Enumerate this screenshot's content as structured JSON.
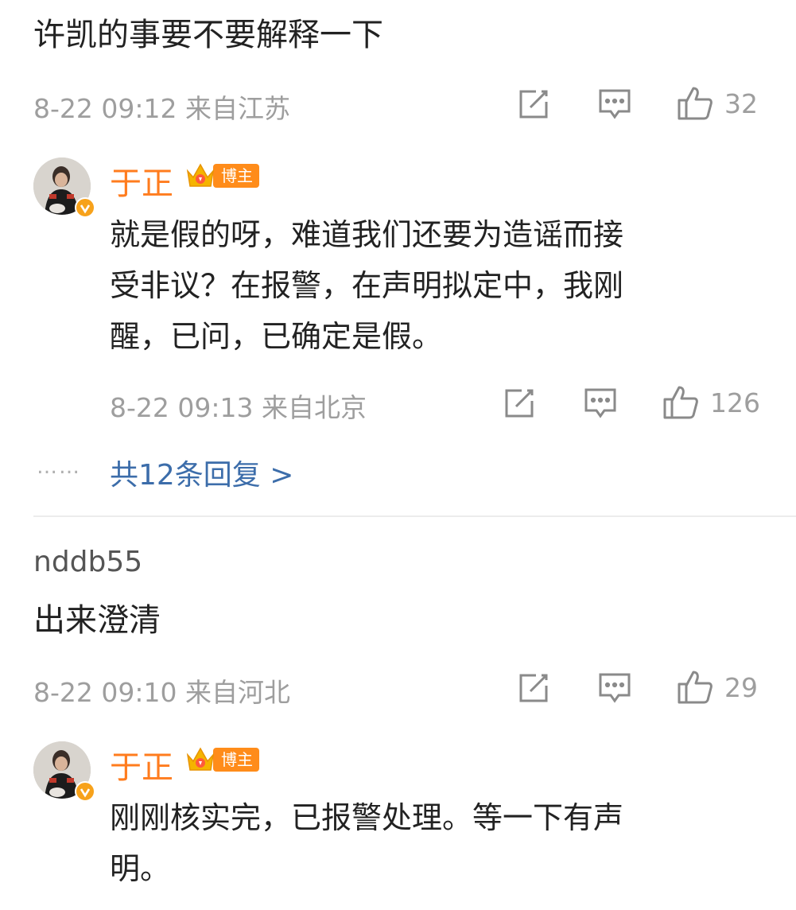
{
  "comments": [
    {
      "text": "许凯的事要不要解释一下",
      "time": "8-22 09:12",
      "location": "来自江苏",
      "likes": "32",
      "reply": {
        "username": "于正",
        "badge": "博主",
        "text_lines": [
          "就是假的呀，难道我们还要为造谣而接",
          "受非议？在报警，在声明拟定中，我刚",
          "醒，已问，已确定是假。"
        ],
        "time": "8-22 09:13",
        "location": "来自北京",
        "likes": "126"
      },
      "more_replies": "共12条回复 >",
      "ellipsis": "……"
    },
    {
      "username": "nddb55",
      "text": "出来澄清",
      "time": "8-22 09:10",
      "location": "来自河北",
      "likes": "29",
      "reply": {
        "username": "于正",
        "badge": "博主",
        "text_lines": [
          "刚刚核实完，已报警处理。等一下有声",
          "明。"
        ]
      }
    }
  ],
  "icons": {
    "edit": "edit-icon",
    "comment": "comment-icon",
    "like": "thumbs-up-icon",
    "crown": "crown-icon",
    "verified": "verified-badge-icon"
  },
  "colors": {
    "username": "#ff7c1e",
    "meta": "#9e9e9e",
    "link": "#3c6daa",
    "badge": "#ff8c1a"
  }
}
